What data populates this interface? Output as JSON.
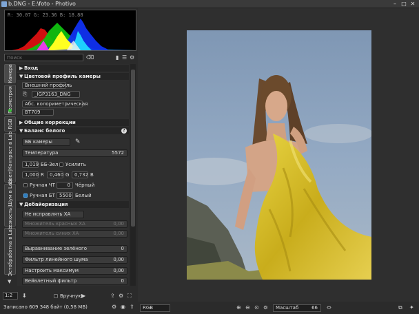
{
  "window": {
    "title": "b.DNG - E:\\foto - Photivo",
    "minimize": "–",
    "restore": "□",
    "close": "✕"
  },
  "histogram": {
    "readout": "R: 30.07   G: 23.36   B: 18.88"
  },
  "search": {
    "placeholder": "Поиск"
  },
  "tabs": [
    "Камера",
    "Геометрия",
    "RGB",
    "Цвет|Контраст в Lab",
    "Резкость|Шум в Lab",
    "Эстобработка в Lab"
  ],
  "sections": {
    "input": "Вход",
    "camera_profile": "Цветовой профиль камеры",
    "general": "Общие коррекции",
    "white_balance": "Баланс белого",
    "demosaic": "Дебайеризация"
  },
  "camera_profile": {
    "external_label": "Внешний профиль",
    "file": "_IGP3163_DNG",
    "intent": "Абс. колориметрическая",
    "gamma": "BT709"
  },
  "white_balance": {
    "preset": "ББ камеры",
    "temperature_label": "Температура",
    "temperature_value": "5572",
    "green_value": "1,019",
    "green_label": "ББ-Зел",
    "amplify_label": "Усилить",
    "r_value": "1,000",
    "r_label": "R",
    "g_value": "0,460",
    "g_label": "G",
    "b_value": "0,732",
    "b_label": "B",
    "black_manual_label": "Ручная ЧТ",
    "black_value": "0",
    "black_label": "Чёрный",
    "white_manual_label": "Ручная БТ",
    "white_value": "5500",
    "white_label": "Белый"
  },
  "demosaic": {
    "ca_mode": "Не исправлять ХА",
    "red_mult_label": "Множитель красных ХА",
    "red_mult_value": "0,00",
    "blue_mult_label": "Множитель синих ХА",
    "blue_mult_value": "0,00",
    "green_eq_label": "Выравнивание зелёного",
    "green_eq_value": "0",
    "line_noise_label": "Фильтр линейного шума",
    "line_noise_value": "0,00",
    "max_label": "Настроить максимум",
    "max_value": "0,00",
    "wavelet_label": "Вейвлетный фильтр",
    "wavelet_value": "0"
  },
  "bottom": {
    "scale": "1:2",
    "manual_label": "Вручную",
    "status": "Записано 609 348 байт (0,58 MB)",
    "colorspace": "RGB",
    "zoom_label": "Масштаб",
    "zoom_value": "66"
  },
  "colors": {
    "accent": "#2e7fc1",
    "panel": "#2e2e2e",
    "header": "#252525"
  }
}
